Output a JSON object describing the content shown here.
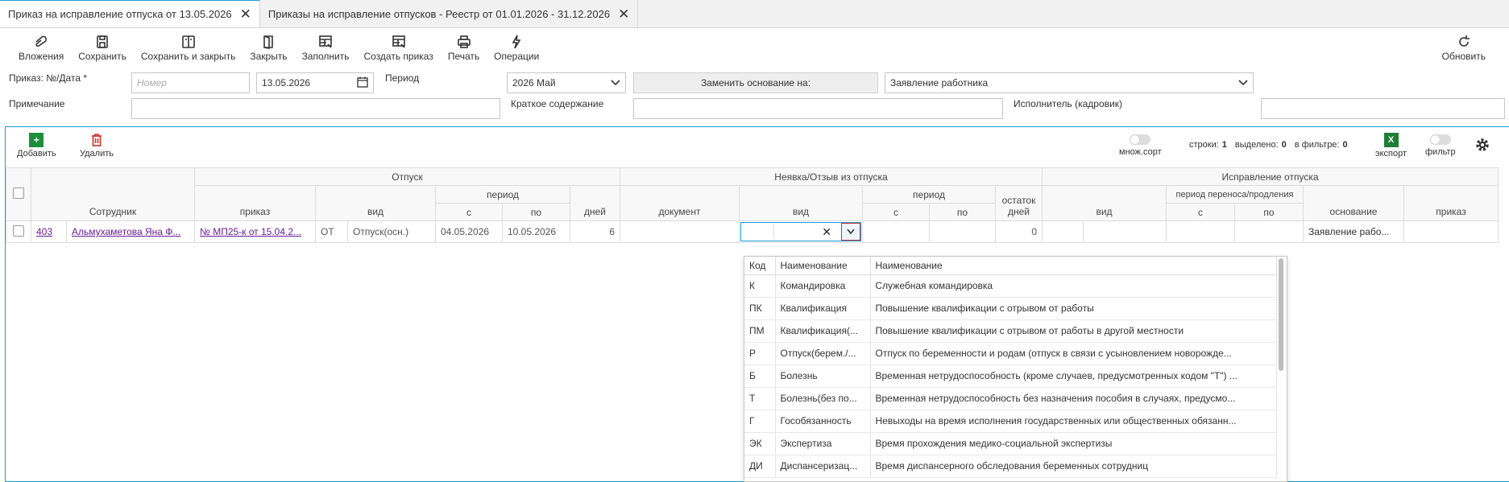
{
  "tabs": [
    {
      "label": "Приказ на исправление отпуска от 13.05.2026"
    },
    {
      "label": "Приказы на исправление отпусков - Реестр от 01.01.2026 - 31.12.2026"
    }
  ],
  "toolbar": {
    "attachments": "Вложения",
    "save": "Сохранить",
    "save_close": "Сохранить и закрыть",
    "close": "Закрыть",
    "fill": "Заполнить",
    "create_order": "Создать приказ",
    "print": "Печать",
    "operations": "Операции",
    "refresh": "Обновить"
  },
  "form": {
    "order_label": "Приказ: №/Дата *",
    "number_placeholder": "Номер",
    "date": "13.05.2026",
    "period_label": "Период",
    "period_value": "2026 Май",
    "replace_basis_button": "Заменить основание на:",
    "basis_value": "Заявление работника",
    "note_label": "Примечание",
    "summary_label": "Краткое содержание",
    "executor_label": "Исполнитель (кадровик)"
  },
  "grid_toolbar": {
    "add": "Добавить",
    "delete": "Удалить",
    "multisort": "множ.сорт",
    "rows_label": "строки:",
    "rows": "1",
    "selected_label": "выделено:",
    "selected": "0",
    "filter_label": "в фильтре:",
    "filtered": "0",
    "export": "экспорт",
    "filter": "фильтр"
  },
  "grid": {
    "groups": {
      "vacation": "Отпуск",
      "absence": "Неявка/Отзыв из отпуска",
      "correction": "Исправление отпуска"
    },
    "headers": {
      "employee": "Сотрудник",
      "order": "приказ",
      "type": "вид",
      "period": "период",
      "from": "с",
      "to": "по",
      "days": "дней",
      "document": "документ",
      "absence_type": "вид",
      "absence_period": "период",
      "absence_from": "с",
      "absence_to": "по",
      "remaining_days": "остаток дней",
      "corr_type": "вид",
      "transfer_period": "период переноса/продления",
      "corr_from": "с",
      "corr_to": "по",
      "basis": "основание",
      "corr_order": "приказ"
    },
    "row": {
      "num": "403",
      "employee": "Альмухаметова Яна Ф...",
      "order": "№ МП25-к от 15.04.2...",
      "type_code": "ОТ",
      "type": "Отпуск(осн.)",
      "from": "04.05.2026",
      "to": "10.05.2026",
      "days": "6",
      "remaining": "0",
      "basis": "Заявление рабо..."
    }
  },
  "dropdown": {
    "headers": [
      "Код",
      "Наименование",
      "Наименование"
    ],
    "rows": [
      {
        "code": "К",
        "name": "Командировка",
        "full": "Служебная командировка"
      },
      {
        "code": "ПК",
        "name": "Квалификация",
        "full": "Повышение квалификации с отрывом от работы"
      },
      {
        "code": "ПМ",
        "name": "Квалификация(...",
        "full": "Повышение квалификации с отрывом от работы в другой местности"
      },
      {
        "code": "Р",
        "name": "Отпуск(берем./...",
        "full": "Отпуск по беременности и родам (отпуск в связи с усыновлением новорожде..."
      },
      {
        "code": "Б",
        "name": "Болезнь",
        "full": "Временная нетрудоспособность (кроме случаев, предусмотренных кодом \"Т\") ..."
      },
      {
        "code": "Т",
        "name": "Болезнь(без по...",
        "full": "Временная нетрудоспособность без назначения пособия в случаях, предусмо..."
      },
      {
        "code": "Г",
        "name": "Гособязанность",
        "full": "Невыходы на время исполнения государственных или общественных обязанн..."
      },
      {
        "code": "ЭК",
        "name": "Экспертиза",
        "full": "Время прохождения медико-социальной экспертизы"
      },
      {
        "code": "ДИ",
        "name": "Диспансеризац...",
        "full": "Время диспансерного обследования беременных сотрудниц"
      }
    ]
  },
  "colors": {
    "accent": "#1a9bd7",
    "add": "#1e8e3e",
    "delete": "#d32f2f",
    "export": "#1e7e34",
    "link": "#6a1b9a"
  }
}
